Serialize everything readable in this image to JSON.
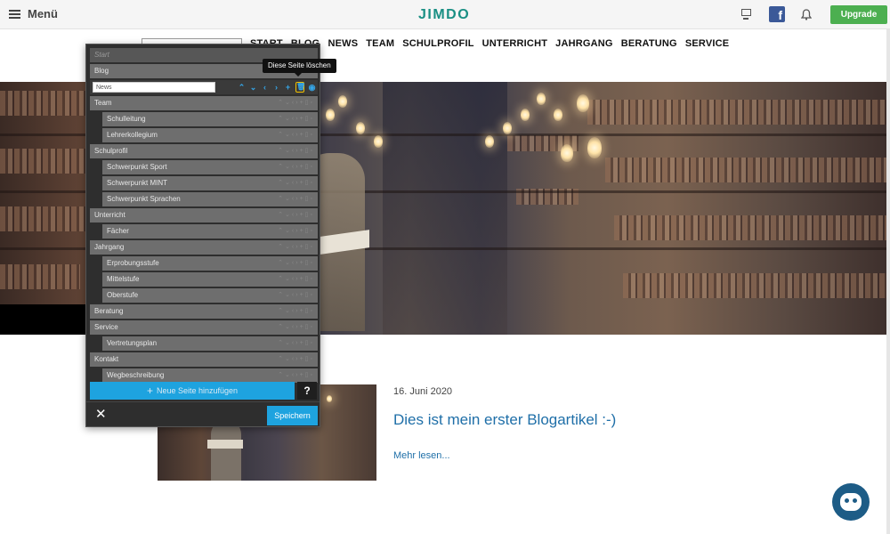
{
  "topbar": {
    "menu_label": "Menü",
    "logo": "JIMDO",
    "upgrade_label": "Upgrade",
    "fb_glyph": "f"
  },
  "site_nav": [
    "START",
    "BLOG",
    "NEWS",
    "TEAM",
    "SCHULPROFIL",
    "UNTERRICHT",
    "JAHRGANG",
    "BERATUNG",
    "SERVICE"
  ],
  "nav_editor": {
    "start_label": "Start",
    "tooltip": "Diese Seite löschen",
    "active_input_value": "News",
    "pages": [
      {
        "label": "Blog",
        "sub": false
      },
      {
        "label": "Team",
        "sub": false
      },
      {
        "label": "Schulleitung",
        "sub": true
      },
      {
        "label": "Lehrerkollegium",
        "sub": true
      },
      {
        "label": "Schulprofil",
        "sub": false
      },
      {
        "label": "Schwerpunkt Sport",
        "sub": true
      },
      {
        "label": "Schwerpunkt MINT",
        "sub": true
      },
      {
        "label": "Schwerpunkt Sprachen",
        "sub": true
      },
      {
        "label": "Unterricht",
        "sub": false
      },
      {
        "label": "Fächer",
        "sub": true
      },
      {
        "label": "Jahrgang",
        "sub": false
      },
      {
        "label": "Erprobungsstufe",
        "sub": true
      },
      {
        "label": "Mittelstufe",
        "sub": true
      },
      {
        "label": "Oberstufe",
        "sub": true
      },
      {
        "label": "Beratung",
        "sub": false
      },
      {
        "label": "Service",
        "sub": false
      },
      {
        "label": "Vertretungsplan",
        "sub": true
      },
      {
        "label": "Kontakt",
        "sub": false
      },
      {
        "label": "Wegbeschreibung",
        "sub": true
      }
    ],
    "add_page_label": "Neue Seite hinzufügen",
    "help_label": "?",
    "close_glyph": "✕",
    "save_label": "Speichern",
    "action_icons": [
      "chevron-up-icon",
      "chevron-down-icon",
      "chevron-left-icon",
      "chevron-right-icon",
      "plus-icon",
      "trash-icon",
      "eye-icon"
    ]
  },
  "blog": {
    "date": "16. Juni 2020",
    "title": "Dies ist mein erster Blogartikel :-)",
    "more_label": "Mehr lesen..."
  },
  "colors": {
    "accent": "#1ea3df",
    "upgrade": "#4caf50",
    "logo": "#1a8f84",
    "link": "#1f6fa8"
  }
}
